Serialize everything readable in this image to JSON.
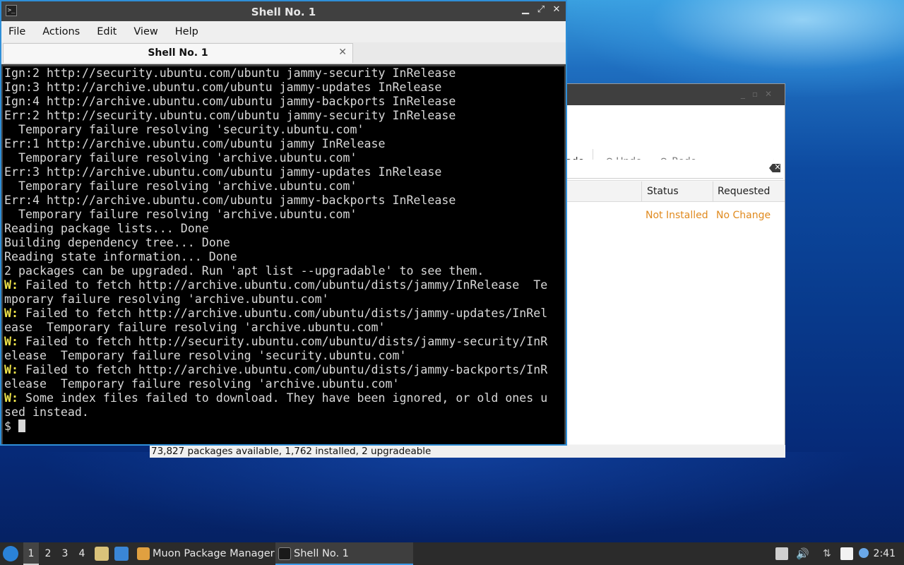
{
  "terminal": {
    "title": "Shell No. 1",
    "menu": [
      "File",
      "Actions",
      "Edit",
      "View",
      "Help"
    ],
    "tab_label": "Shell No. 1",
    "lines": [
      {
        "t": "Ign:2 http://security.ubuntu.com/ubuntu jammy-security InRelease"
      },
      {
        "t": "Ign:3 http://archive.ubuntu.com/ubuntu jammy-updates InRelease"
      },
      {
        "t": "Ign:4 http://archive.ubuntu.com/ubuntu jammy-backports InRelease"
      },
      {
        "t": "Err:2 http://security.ubuntu.com/ubuntu jammy-security InRelease"
      },
      {
        "t": "  Temporary failure resolving 'security.ubuntu.com'"
      },
      {
        "t": "Err:1 http://archive.ubuntu.com/ubuntu jammy InRelease"
      },
      {
        "t": "  Temporary failure resolving 'archive.ubuntu.com'"
      },
      {
        "t": "Err:3 http://archive.ubuntu.com/ubuntu jammy-updates InRelease"
      },
      {
        "t": "  Temporary failure resolving 'archive.ubuntu.com'"
      },
      {
        "t": "Err:4 http://archive.ubuntu.com/ubuntu jammy-backports InRelease"
      },
      {
        "t": "  Temporary failure resolving 'archive.ubuntu.com'"
      },
      {
        "t": "Reading package lists... Done"
      },
      {
        "t": "Building dependency tree... Done"
      },
      {
        "t": "Reading state information... Done"
      },
      {
        "t": "2 packages can be upgraded. Run 'apt list --upgradable' to see them."
      },
      {
        "w": "W:",
        "t": " Failed to fetch http://archive.ubuntu.com/ubuntu/dists/jammy/InRelease  Te"
      },
      {
        "t": "mporary failure resolving 'archive.ubuntu.com'"
      },
      {
        "w": "W:",
        "t": " Failed to fetch http://archive.ubuntu.com/ubuntu/dists/jammy-updates/InRel"
      },
      {
        "t": "ease  Temporary failure resolving 'archive.ubuntu.com'"
      },
      {
        "w": "W:",
        "t": " Failed to fetch http://security.ubuntu.com/ubuntu/dists/jammy-security/InR"
      },
      {
        "t": "elease  Temporary failure resolving 'security.ubuntu.com'"
      },
      {
        "w": "W:",
        "t": " Failed to fetch http://archive.ubuntu.com/ubuntu/dists/jammy-backports/InR"
      },
      {
        "t": "elease  Temporary failure resolving 'archive.ubuntu.com'"
      },
      {
        "w": "W:",
        "t": " Some index files failed to download. They have been ignored, or old ones u"
      },
      {
        "t": "sed instead."
      }
    ],
    "prompt": "$ ",
    "warn_color": "#f0e44a"
  },
  "muon": {
    "toolbar": {
      "partial_label": "ade",
      "undo": "Undo",
      "redo": "Redo"
    },
    "columns": {
      "status": "Status",
      "requested": "Requested"
    },
    "row": {
      "status": "Not Installed",
      "requested": "No Change"
    },
    "statusbar": "73,827 packages available, 1,762 installed, 2 upgradeable",
    "status_color": "#e08a1e"
  },
  "taskbar": {
    "workspaces": [
      "1",
      "2",
      "3",
      "4"
    ],
    "tasks": [
      {
        "label": "Muon Package Manager",
        "icon": "muon-icon"
      },
      {
        "label": "Shell No. 1",
        "icon": "terminal-icon"
      }
    ],
    "clock": "2:41"
  }
}
